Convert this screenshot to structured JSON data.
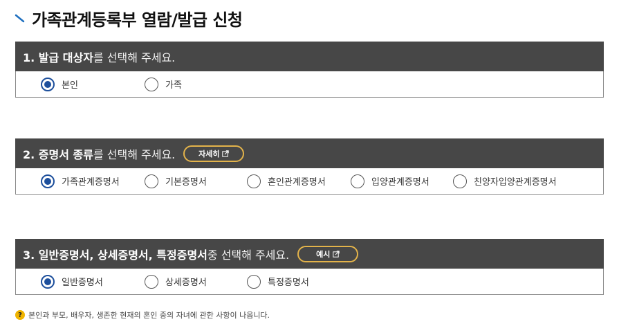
{
  "page": {
    "title": "가족관계등록부 열람/발급 신청"
  },
  "sections": [
    {
      "heading_strong": "1. 발급 대상자",
      "heading_rest": "를 선택해 주세요.",
      "options": [
        "본인",
        "가족"
      ],
      "selected": "본인"
    },
    {
      "heading_strong": "2. 증명서 종류",
      "heading_rest": "를 선택해 주세요.",
      "button_label": "자세히",
      "options": [
        "가족관계증명서",
        "기본증명서",
        "혼인관계증명서",
        "입양관계증명서",
        "친양자입양관계증명서"
      ],
      "selected": "가족관계증명서"
    },
    {
      "heading_strong": "3. 일반증명서, 상세증명서, 특정증명서",
      "heading_rest": " 중 선택해 주세요.",
      "button_label": "예시",
      "options": [
        "일반증명서",
        "상세증명서",
        "특정증명서"
      ],
      "selected": "일반증명서"
    }
  ],
  "note": {
    "icon": "question-icon",
    "icon_glyph": "?",
    "text": "본인과 부모, 배우자, 생존한 현재의 혼인 중의 자녀에 관한 사항이 나옵니다."
  },
  "colors": {
    "header_bg": "#474747",
    "pill_border": "#e3b34a",
    "radio_selected": "#1d4f9c",
    "note_icon": "#f0b400"
  }
}
